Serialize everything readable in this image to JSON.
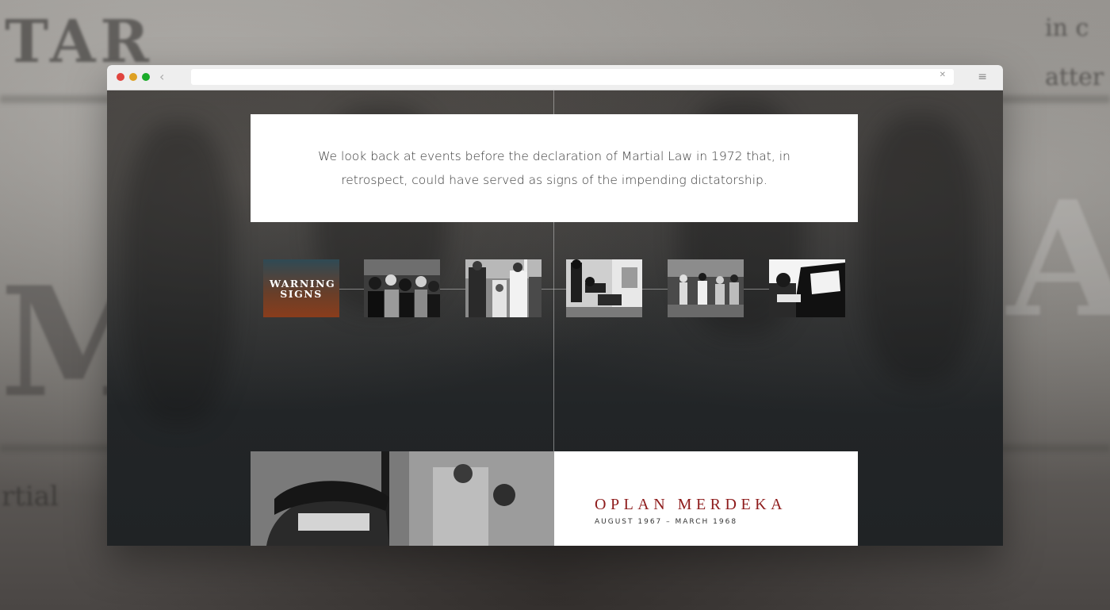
{
  "page": {
    "intro": "We look back at events before the declaration of Martial Law in 1972 that, in retrospect, could have served as signs of the impending dictatorship.",
    "timeline": {
      "items": [
        {
          "label": "WARNING\nSIGNS",
          "icon": "warning-signs-title-icon"
        },
        {
          "icon": "rebels-group-photo"
        },
        {
          "icon": "oath-taking-photo"
        },
        {
          "icon": "street-clash-photo"
        },
        {
          "icon": "crowd-riot-photo"
        },
        {
          "icon": "car-shooting-photo"
        }
      ]
    },
    "story": {
      "title": "OPLAN MERDEKA",
      "dates": "AUGUST 1967 – MARCH 1968"
    }
  },
  "backdrop": {
    "words": [
      "TAR",
      "in c",
      "atter",
      "rtial"
    ]
  },
  "colors": {
    "accent": "#8e1b1b",
    "dark_bg": "#222527",
    "card_bg": "#ffffff"
  }
}
